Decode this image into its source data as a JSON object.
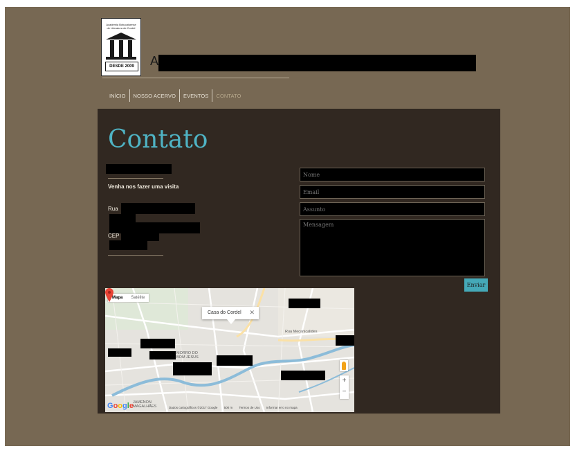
{
  "header": {
    "logo_caption": "Academia Botucatuense de Literatura de Cordel",
    "logo_since": "DESDE 2009",
    "title_visible": "A"
  },
  "nav": {
    "items": [
      {
        "label": "INÍCIO"
      },
      {
        "label": "NOSSO ACERVO"
      },
      {
        "label": "EVENTOS"
      },
      {
        "label": "CONTATO",
        "active": true
      }
    ]
  },
  "contact": {
    "page_title": "Contato",
    "visit_heading": "Venha nos fazer uma visita",
    "street_prefix": "Rua",
    "cep_label": "CEP"
  },
  "form": {
    "name_placeholder": "Nome",
    "email_placeholder": "Email",
    "subject_placeholder": "Assunto",
    "message_placeholder": "Mensagem",
    "submit_label": "Enviar"
  },
  "map": {
    "type_map": "Mapa",
    "type_satellite": "Satélite",
    "infowindow_title": "Casa do Cordel",
    "infowindow_close": "✕",
    "area_label_1": "MORRO DO BOM JESUS",
    "area_label_2": "Rua Mecanicalides",
    "area_label_3": "JAMENON MAGALHÃES",
    "zoom_in": "+",
    "zoom_out": "−",
    "logo": "Google",
    "footer_data": "Dados cartográficos ©2017 Google",
    "footer_scale": "500 m",
    "footer_terms": "Termos de Uso",
    "footer_report": "Informar erro no mapa"
  },
  "colors": {
    "page_background": "#776853",
    "panel_background": "#312821",
    "accent": "#4fb3c4",
    "nav_active": "#b7a98d"
  }
}
